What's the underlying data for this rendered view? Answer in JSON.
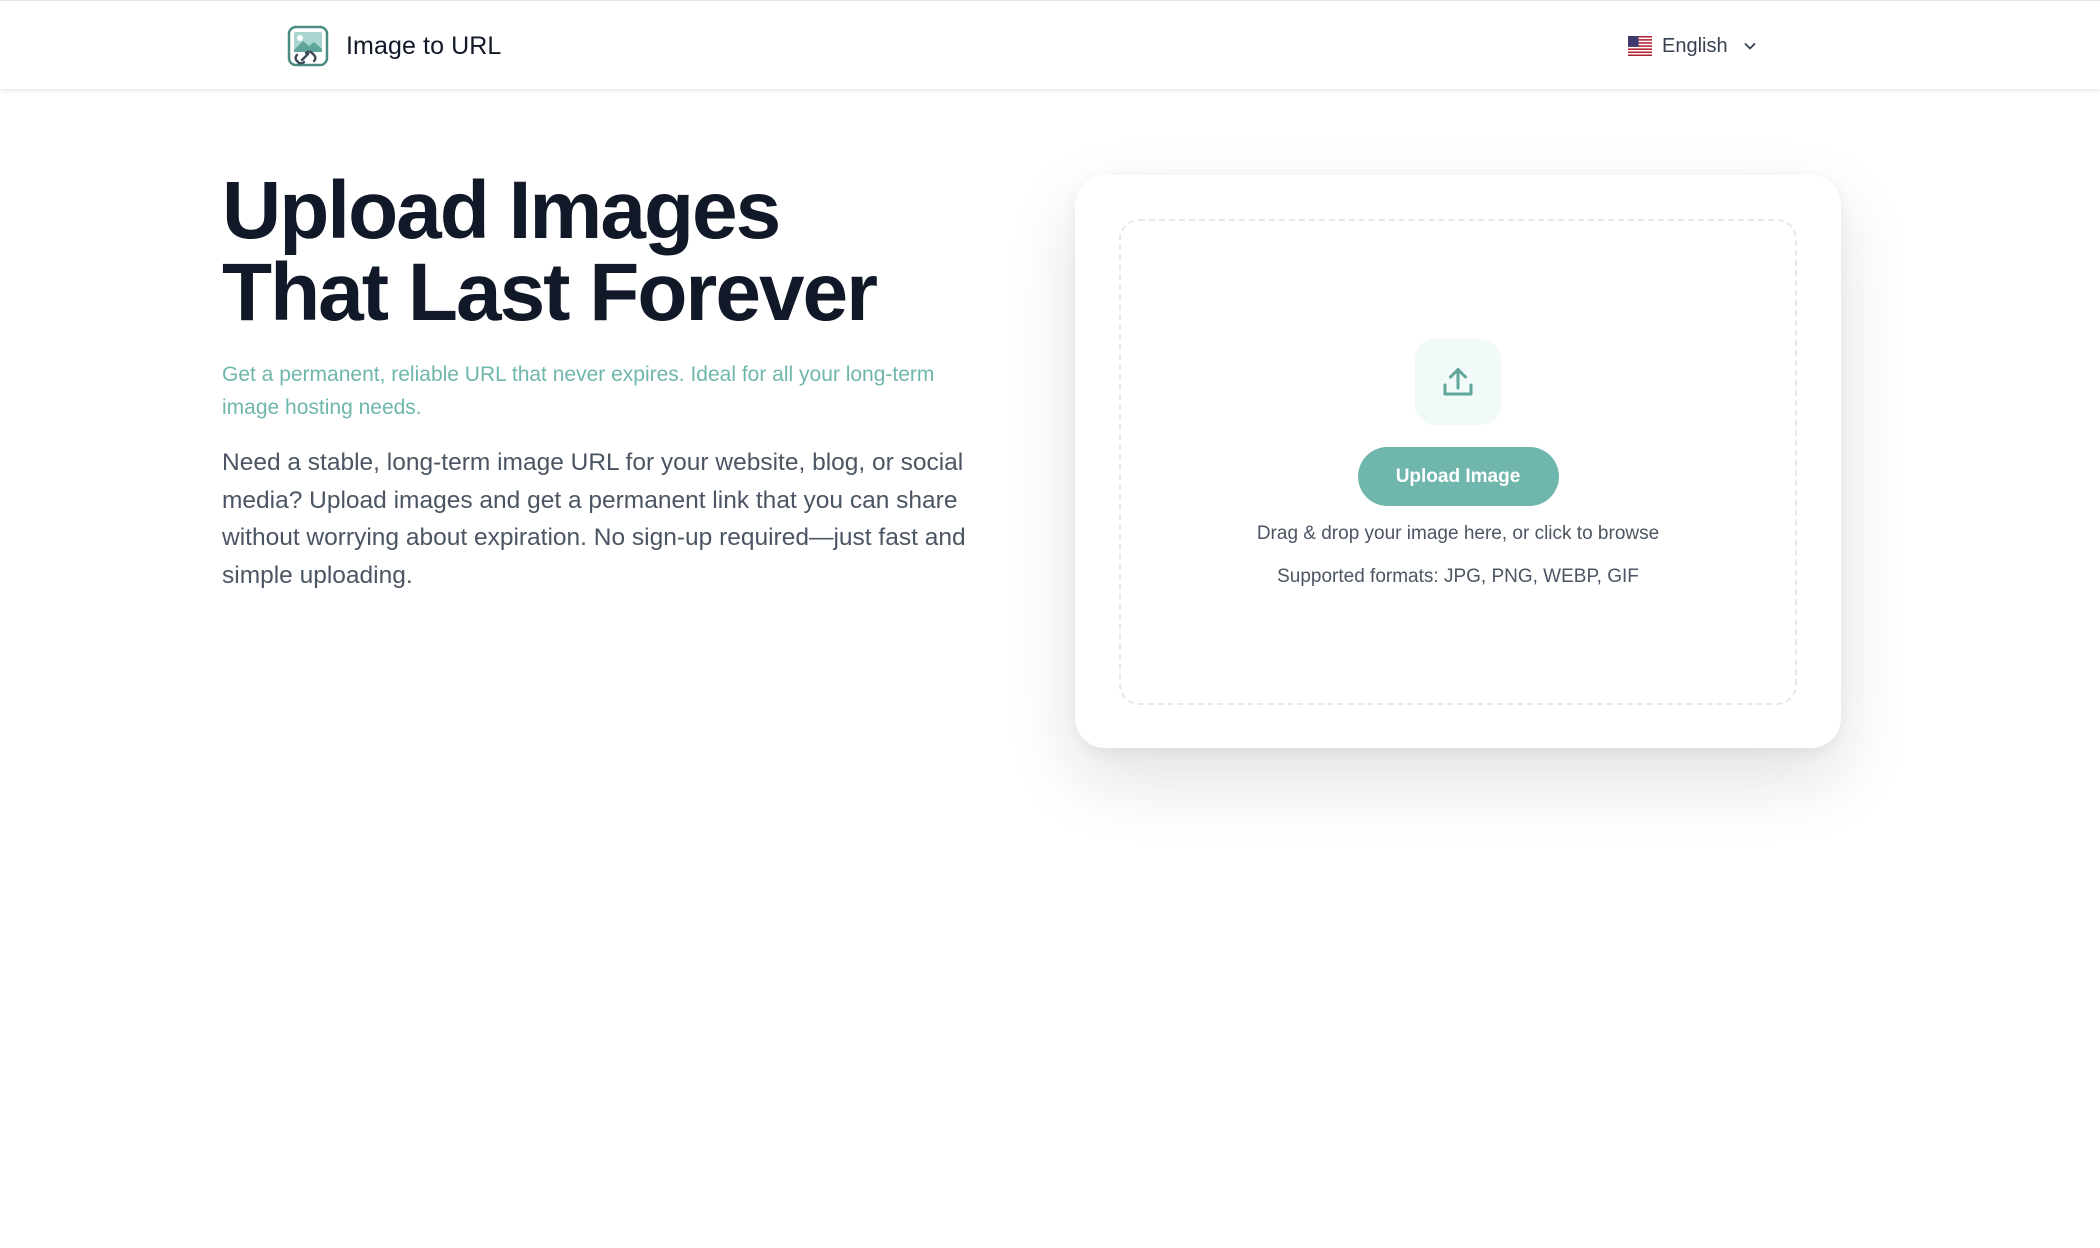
{
  "header": {
    "brand_name": "Image to URL",
    "logo_icon": "image-link-icon",
    "language": {
      "label": "English",
      "flag_icon": "us-flag-icon",
      "chevron_icon": "chevron-down-icon"
    }
  },
  "hero": {
    "title_line1": "Upload Images",
    "title_line2": "That Last Forever",
    "subtitle": "Get a permanent, reliable URL that never expires. Ideal for all your long-term image hosting needs.",
    "description": "Need a stable, long-term image URL for your website, blog, or social media? Upload images and get a permanent link that you can share without worrying about expiration. No sign-up required—just fast and simple uploading."
  },
  "uploader": {
    "icon": "upload-icon",
    "button_label": "Upload Image",
    "drop_hint": "Drag & drop your image here, or click to browse",
    "formats": "Supported formats: JPG, PNG, WEBP, GIF"
  },
  "colors": {
    "accent": "#6fb6ad",
    "accent_light": "#f1faf8",
    "heading": "#111827",
    "body_text": "#4b5563"
  }
}
